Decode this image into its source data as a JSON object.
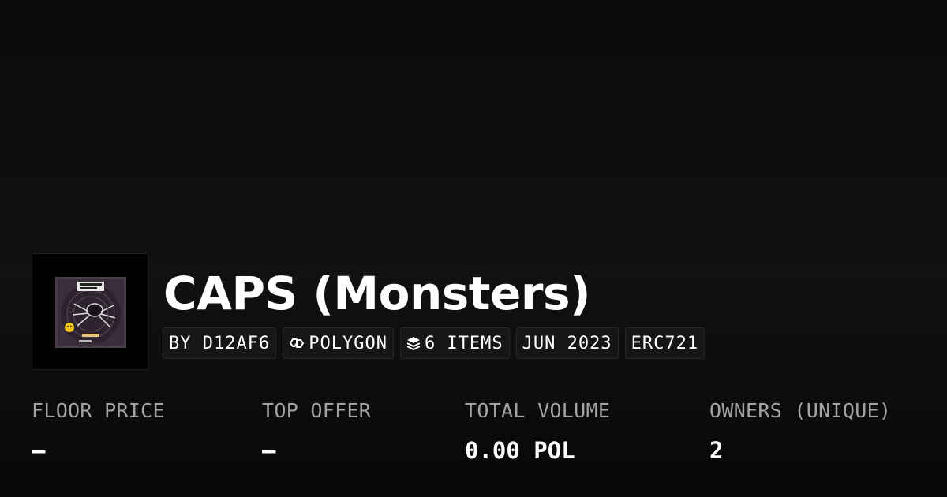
{
  "collection": {
    "title": "CAPS (Monsters)",
    "image_icon": "collection-artwork-icon"
  },
  "chips": [
    {
      "label": "BY D12AF6",
      "icon": null
    },
    {
      "label": "POLYGON",
      "icon": "polygon-chain-icon"
    },
    {
      "label": "6 ITEMS",
      "icon": "layers-icon"
    },
    {
      "label": "JUN 2023",
      "icon": null
    },
    {
      "label": "ERC721",
      "icon": null
    }
  ],
  "stats": [
    {
      "label": "FLOOR PRICE",
      "value": "–"
    },
    {
      "label": "TOP OFFER",
      "value": "–"
    },
    {
      "label": "TOTAL VOLUME",
      "value": "0.00 POL"
    },
    {
      "label": "OWNERS (UNIQUE)",
      "value": "2"
    }
  ],
  "colors": {
    "background": "#0a0a0a",
    "chip_background": "#161616",
    "label_text": "#a3a3a3",
    "text": "#ffffff"
  }
}
